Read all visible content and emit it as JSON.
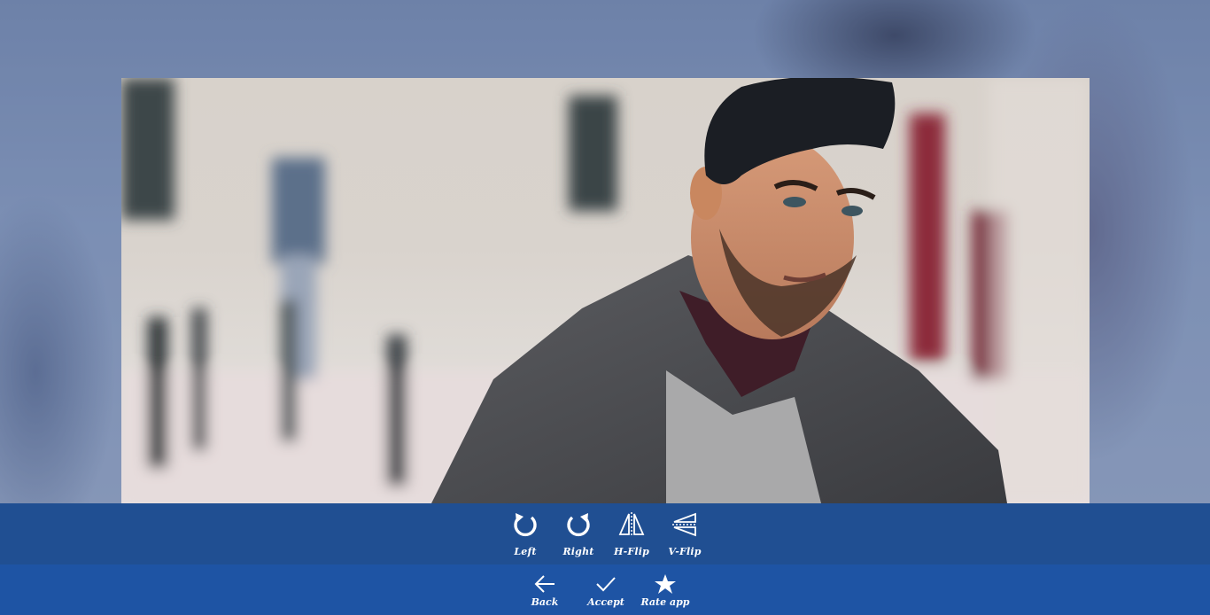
{
  "image": {
    "subject": "portrait-photo"
  },
  "toolbar": {
    "items": [
      {
        "label": "Left",
        "icon": "rotate-left-icon"
      },
      {
        "label": "Right",
        "icon": "rotate-right-icon"
      },
      {
        "label": "H-Flip",
        "icon": "flip-horizontal-icon"
      },
      {
        "label": "V-Flip",
        "icon": "flip-vertical-icon"
      }
    ]
  },
  "nav": {
    "items": [
      {
        "label": "Back",
        "icon": "back-arrow-icon"
      },
      {
        "label": "Accept",
        "icon": "checkmark-icon"
      },
      {
        "label": "Rate app",
        "icon": "star-icon"
      }
    ]
  },
  "colors": {
    "toolbar_bg": "#204f92",
    "navbar_bg": "#1e54a4",
    "icon": "#ffffff"
  }
}
